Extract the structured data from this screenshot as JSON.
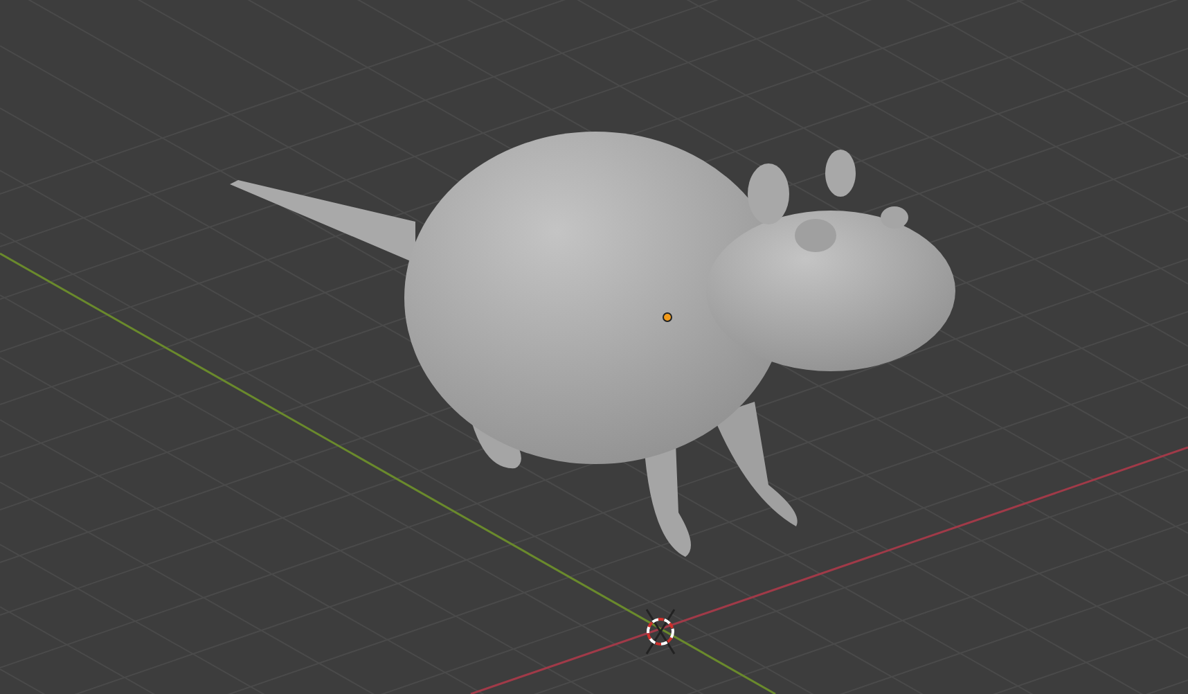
{
  "viewport": {
    "axes": [
      {
        "kind": "x",
        "color": "#a03a48"
      },
      {
        "kind": "y",
        "color": "#6a8a2c"
      }
    ],
    "origin_marker": true,
    "cursor_3d": true
  }
}
